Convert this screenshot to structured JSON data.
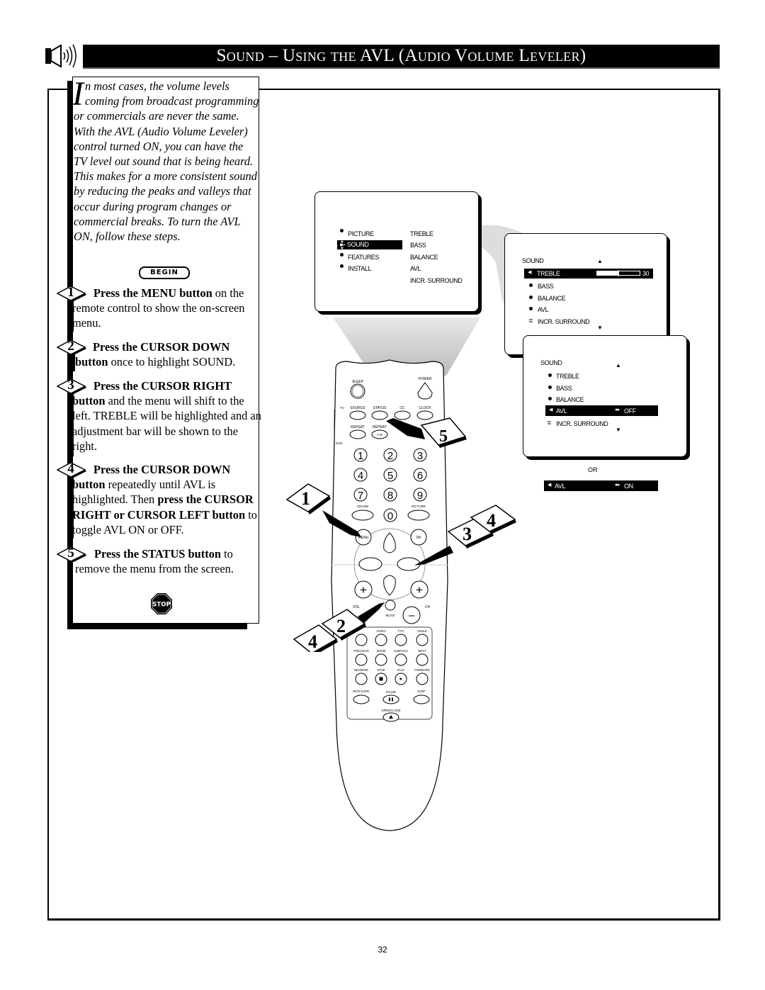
{
  "header": {
    "title": "Sound – Using the AVL (Audio Volume Leveler)",
    "icon": "speaker-icon"
  },
  "intro": {
    "drop_cap": "I",
    "text": "n most cases, the volume levels coming from broadcast programming or commercials are never the same.  With the AVL (Audio Volume Leveler) control turned ON, you can have the TV level out sound that is being heard.  This makes for a more consistent sound by reducing the peaks and valleys that occur during program changes or commercial breaks.  To turn the AVL ON, follow these steps."
  },
  "begin_label": "BEGIN",
  "steps": [
    {
      "num": "1",
      "bold": "Press the MENU button",
      "rest": " on the remote control to show the on-screen menu."
    },
    {
      "num": "2",
      "bold": "Press the CURSOR DOWN button",
      "rest": " once to highlight SOUND."
    },
    {
      "num": "3",
      "bold": "Press the CURSOR RIGHT button",
      "rest": " and the menu will shift to the left. TREBLE will be highlighted and an adjustment bar will be shown to the right."
    },
    {
      "num": "4",
      "bold": "Press the CURSOR DOWN button",
      "rest": " repeatedly until AVL is highlighted.  Then ",
      "bold2": "press the CURSOR RIGHT or CURSOR LEFT button",
      "rest2": " to toggle AVL ON or OFF."
    },
    {
      "num": "5",
      "bold": "Press the STATUS button",
      "rest": " to remove the menu from the screen."
    }
  ],
  "stop_label": "STOP",
  "osd_main": {
    "left": [
      "PICTURE",
      "SOUND",
      "FEATURES",
      "INSTALL"
    ],
    "right": [
      "TREBLE",
      "BASS",
      "BALANCE",
      "AVL",
      "INCR. SURROUND"
    ],
    "selected": "SOUND"
  },
  "osd_sound": {
    "title": "SOUND",
    "items": [
      "TREBLE",
      "BASS",
      "BALANCE",
      "AVL",
      "INCR. SURROUND"
    ],
    "selected": "TREBLE",
    "treble_value": "30",
    "treble_level": 0.5
  },
  "osd_avl": {
    "title": "SOUND",
    "items": [
      "TREBLE",
      "BASS",
      "BALANCE",
      "AVL",
      "INCR. SURROUND"
    ],
    "selected": "AVL",
    "avl_value": "OFF"
  },
  "or_label": "OR",
  "avl_alt": {
    "label": "AVL",
    "value": "ON"
  },
  "remote": {
    "top_buttons": [
      "SLEEP",
      "POWER"
    ],
    "row2": [
      "SOURCE",
      "STATUS",
      "CC",
      "CLOCK"
    ],
    "row3": [
      "REPEAT",
      "REPEAT"
    ],
    "repeat_ab": "A-B",
    "mode_labels": [
      "TV",
      "DVD"
    ],
    "digits": [
      "1",
      "2",
      "3",
      "4",
      "5",
      "6",
      "7",
      "8",
      "9",
      "0"
    ],
    "sound": "SOUND",
    "picture": "PICTURE",
    "menu": "MENU",
    "ok": "OK",
    "vol": "VOL",
    "ch": "CH",
    "mute": "MUTE",
    "plus": "+",
    "minus": "–",
    "dvd_row1": [
      "AUDIO",
      "FTS",
      "ANGLE"
    ],
    "dvd_row2": [
      "PREVIOUS",
      "ZOOM",
      "SUBTITLE",
      "NEXT"
    ],
    "dvd_row3": [
      "REVERSE",
      "STOP",
      "PLAY",
      "FORWARD"
    ],
    "dvd_row4": [
      "INCR.SURR.",
      "PAUSE",
      "SURF"
    ],
    "open_close": "OPEN/CLOSE"
  },
  "callouts": [
    "1",
    "2",
    "3",
    "4",
    "4",
    "5"
  ],
  "page_number": "32"
}
